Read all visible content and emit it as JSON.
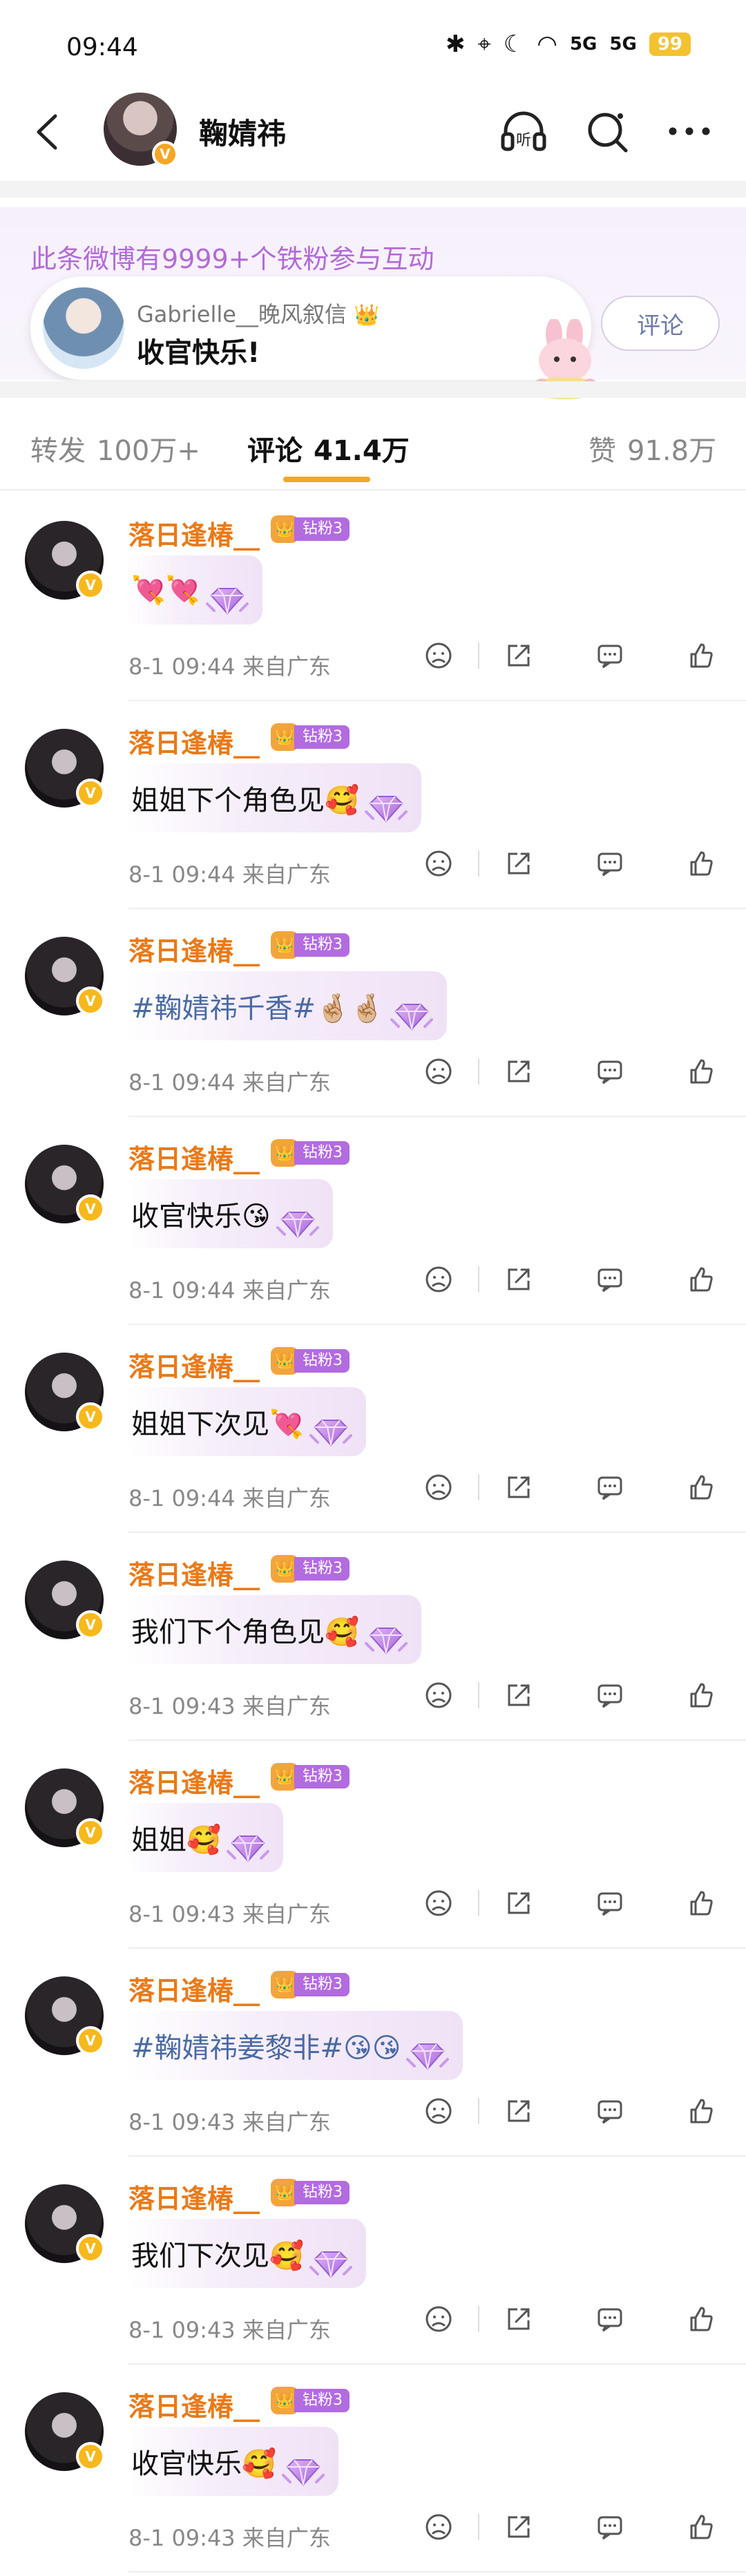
{
  "status_bar": {
    "time": "09:44",
    "signal1": "5G",
    "signal2": "5G",
    "battery": "99"
  },
  "header": {
    "title": "鞠婧祎",
    "listen_icon_label": "听",
    "accent": "#f5a623"
  },
  "fan_banner": {
    "title": "此条微博有9999+个铁粉参与互动",
    "user_name": "Gabrielle__晚风叙信",
    "comment": "收官快乐!",
    "reply_button": "评论",
    "title_color": "#b26bd6"
  },
  "tabs": [
    {
      "label": "转发",
      "count": "100万+"
    },
    {
      "label": "评论",
      "count": "41.4万",
      "active": true
    },
    {
      "label": "赞",
      "count": "91.8万"
    }
  ],
  "fan_badge_level": "钻粉3",
  "comments": [
    {
      "user": "落日逢椿__",
      "text": "💘💘",
      "date": "8-1",
      "time": "09:44",
      "location": "来自广东"
    },
    {
      "user": "落日逢椿__",
      "text": "姐姐下个角色见🥰",
      "date": "8-1",
      "time": "09:44",
      "location": "来自广东"
    },
    {
      "user": "落日逢椿__",
      "text": "#鞠婧祎千香#🤞🏼🤞🏼",
      "date": "8-1",
      "time": "09:44",
      "location": "来自广东",
      "is_tag": true
    },
    {
      "user": "落日逢椿__",
      "text": "收官快乐😘",
      "date": "8-1",
      "time": "09:44",
      "location": "来自广东"
    },
    {
      "user": "落日逢椿__",
      "text": "姐姐下次见💘",
      "date": "8-1",
      "time": "09:44",
      "location": "来自广东"
    },
    {
      "user": "落日逢椿__",
      "text": "我们下个角色见🥰",
      "date": "8-1",
      "time": "09:43",
      "location": "来自广东"
    },
    {
      "user": "落日逢椿__",
      "text": "姐姐🥰",
      "date": "8-1",
      "time": "09:43",
      "location": "来自广东"
    },
    {
      "user": "落日逢椿__",
      "text": "#鞠婧祎姜黎非#😘😘",
      "date": "8-1",
      "time": "09:43",
      "location": "来自广东",
      "is_tag": true
    },
    {
      "user": "落日逢椿__",
      "text": "我们下次见🥰",
      "date": "8-1",
      "time": "09:43",
      "location": "来自广东"
    },
    {
      "user": "落日逢椿__",
      "text": "收官快乐🥰",
      "date": "8-1",
      "time": "09:43",
      "location": "来自广东"
    }
  ],
  "icons": {
    "back": "chevron-left-icon",
    "listen": "headphones-icon",
    "search": "search-icon",
    "more": "more-dots-icon",
    "dislike": "dislike-face-icon",
    "share": "share-icon",
    "reply": "comment-icon",
    "like": "thumbs-up-icon"
  }
}
